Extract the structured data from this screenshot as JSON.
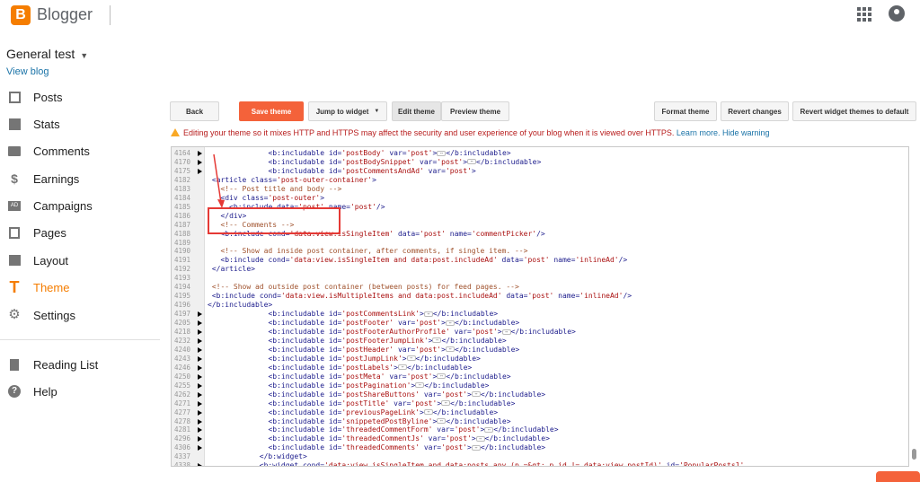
{
  "app": {
    "logo_letter": "B",
    "title": "Blogger"
  },
  "blog": {
    "name": "General test",
    "view_link": "View blog"
  },
  "sidebar": {
    "items": [
      {
        "label": "Posts",
        "icon": "posts-icon"
      },
      {
        "label": "Stats",
        "icon": "stats-icon"
      },
      {
        "label": "Comments",
        "icon": "comments-icon"
      },
      {
        "label": "Earnings",
        "icon": "earnings-icon"
      },
      {
        "label": "Campaigns",
        "icon": "campaigns-icon"
      },
      {
        "label": "Pages",
        "icon": "pages-icon"
      },
      {
        "label": "Layout",
        "icon": "layout-icon"
      },
      {
        "label": "Theme",
        "icon": "theme-icon",
        "active": true
      },
      {
        "label": "Settings",
        "icon": "settings-icon"
      }
    ],
    "secondary": [
      {
        "label": "Reading List",
        "icon": "reading-list-icon"
      },
      {
        "label": "Help",
        "icon": "help-icon"
      }
    ]
  },
  "toolbar": {
    "back": "Back",
    "save_theme": "Save theme",
    "jump_to_widget": "Jump to widget",
    "edit_theme": "Edit theme",
    "preview_theme": "Preview theme",
    "format_theme": "Format theme",
    "revert_changes": "Revert changes",
    "revert_widgets": "Revert widget themes to default"
  },
  "warning": {
    "message": "Editing your theme so it mixes HTTP and HTTPS may affect the security and user experience of your blog when it is viewed over HTTPS.",
    "learn_more": "Learn more.",
    "hide_warning": "Hide warning"
  },
  "code_lines": [
    {
      "ln": "4164",
      "fold": true,
      "indent": 14,
      "parts": [
        [
          "tag",
          "<b:includable "
        ],
        [
          "attr",
          "id="
        ],
        [
          "str",
          "'postBody'"
        ],
        [
          "attr",
          " var="
        ],
        [
          "str",
          "'post'"
        ],
        [
          "tag",
          ">"
        ],
        [
          "ell",
          ""
        ],
        [
          "tag",
          "</b:includable>"
        ]
      ]
    },
    {
      "ln": "4170",
      "fold": true,
      "indent": 14,
      "parts": [
        [
          "tag",
          "<b:includable "
        ],
        [
          "attr",
          "id="
        ],
        [
          "str",
          "'postBodySnippet'"
        ],
        [
          "attr",
          " var="
        ],
        [
          "str",
          "'post'"
        ],
        [
          "tag",
          ">"
        ],
        [
          "ell",
          ""
        ],
        [
          "tag",
          "</b:includable>"
        ]
      ]
    },
    {
      "ln": "4175",
      "fold": true,
      "indent": 14,
      "parts": [
        [
          "tag",
          "<b:includable "
        ],
        [
          "attr",
          "id="
        ],
        [
          "str",
          "'postCommentsAndAd'"
        ],
        [
          "attr",
          " var="
        ],
        [
          "str",
          "'post'"
        ],
        [
          "tag",
          ">"
        ]
      ]
    },
    {
      "ln": "4182",
      "fold": false,
      "indent": 1,
      "parts": [
        [
          "tag",
          "<article "
        ],
        [
          "attr",
          "class="
        ],
        [
          "str",
          "'post-outer-container'"
        ],
        [
          "tag",
          ">"
        ]
      ]
    },
    {
      "ln": "4183",
      "fold": false,
      "indent": 3,
      "parts": [
        [
          "cmt",
          "<!-- Post title and body -->"
        ]
      ]
    },
    {
      "ln": "4184",
      "fold": false,
      "indent": 3,
      "parts": [
        [
          "tag",
          "<div "
        ],
        [
          "attr",
          "class="
        ],
        [
          "str",
          "'post-outer'"
        ],
        [
          "tag",
          ">"
        ]
      ]
    },
    {
      "ln": "4185",
      "fold": false,
      "indent": 5,
      "parts": [
        [
          "tag",
          "<b:include "
        ],
        [
          "attr",
          "data="
        ],
        [
          "str",
          "'post'"
        ],
        [
          "attr",
          " name="
        ],
        [
          "str",
          "'post'"
        ],
        [
          "tag",
          "/>"
        ]
      ]
    },
    {
      "ln": "4186",
      "fold": false,
      "indent": 3,
      "parts": [
        [
          "tag",
          "</div>"
        ]
      ]
    },
    {
      "ln": "4187",
      "fold": false,
      "indent": 3,
      "parts": [
        [
          "cmt",
          "<!-- Comments -->"
        ]
      ]
    },
    {
      "ln": "4188",
      "fold": false,
      "indent": 3,
      "parts": [
        [
          "tag",
          "<b:include "
        ],
        [
          "attr",
          "cond="
        ],
        [
          "str",
          "'data:view.isSingleItem'"
        ],
        [
          "attr",
          " data="
        ],
        [
          "str",
          "'post'"
        ],
        [
          "attr",
          " name="
        ],
        [
          "str",
          "'commentPicker'"
        ],
        [
          "tag",
          "/>"
        ]
      ]
    },
    {
      "ln": "4189",
      "fold": false,
      "indent": 0,
      "parts": []
    },
    {
      "ln": "4190",
      "fold": false,
      "indent": 3,
      "parts": [
        [
          "cmt",
          "<!-- Show ad inside post container, after comments, if single item. -->"
        ]
      ]
    },
    {
      "ln": "4191",
      "fold": false,
      "indent": 3,
      "parts": [
        [
          "tag",
          "<b:include "
        ],
        [
          "attr",
          "cond="
        ],
        [
          "str",
          "'data:view.isSingleItem and data:post.includeAd'"
        ],
        [
          "attr",
          " data="
        ],
        [
          "str",
          "'post'"
        ],
        [
          "attr",
          " name="
        ],
        [
          "str",
          "'inlineAd'"
        ],
        [
          "tag",
          "/>"
        ]
      ]
    },
    {
      "ln": "4192",
      "fold": false,
      "indent": 1,
      "parts": [
        [
          "tag",
          "</article>"
        ]
      ]
    },
    {
      "ln": "4193",
      "fold": false,
      "indent": 0,
      "parts": []
    },
    {
      "ln": "4194",
      "fold": false,
      "indent": 1,
      "parts": [
        [
          "cmt",
          "<!-- Show ad outside post container (between posts) for feed pages. -->"
        ]
      ]
    },
    {
      "ln": "4195",
      "fold": false,
      "indent": 1,
      "parts": [
        [
          "tag",
          "<b:include "
        ],
        [
          "attr",
          "cond="
        ],
        [
          "str",
          "'data:view.isMultipleItems and data:post.includeAd'"
        ],
        [
          "attr",
          " data="
        ],
        [
          "str",
          "'post'"
        ],
        [
          "attr",
          " name="
        ],
        [
          "str",
          "'inlineAd'"
        ],
        [
          "tag",
          "/>"
        ]
      ]
    },
    {
      "ln": "4196",
      "fold": false,
      "indent": 0,
      "parts": [
        [
          "tag",
          "</b:includable>"
        ]
      ]
    },
    {
      "ln": "4197",
      "fold": true,
      "indent": 14,
      "parts": [
        [
          "tag",
          "<b:includable "
        ],
        [
          "attr",
          "id="
        ],
        [
          "str",
          "'postCommentsLink'"
        ],
        [
          "tag",
          ">"
        ],
        [
          "ell",
          ""
        ],
        [
          "tag",
          "</b:includable>"
        ]
      ]
    },
    {
      "ln": "4205",
      "fold": true,
      "indent": 14,
      "parts": [
        [
          "tag",
          "<b:includable "
        ],
        [
          "attr",
          "id="
        ],
        [
          "str",
          "'postFooter'"
        ],
        [
          "attr",
          " var="
        ],
        [
          "str",
          "'post'"
        ],
        [
          "tag",
          ">"
        ],
        [
          "ell",
          ""
        ],
        [
          "tag",
          "</b:includable>"
        ]
      ]
    },
    {
      "ln": "4218",
      "fold": true,
      "indent": 14,
      "parts": [
        [
          "tag",
          "<b:includable "
        ],
        [
          "attr",
          "id="
        ],
        [
          "str",
          "'postFooterAuthorProfile'"
        ],
        [
          "attr",
          " var="
        ],
        [
          "str",
          "'post'"
        ],
        [
          "tag",
          ">"
        ],
        [
          "ell",
          ""
        ],
        [
          "tag",
          "</b:includable>"
        ]
      ]
    },
    {
      "ln": "4232",
      "fold": true,
      "indent": 14,
      "parts": [
        [
          "tag",
          "<b:includable "
        ],
        [
          "attr",
          "id="
        ],
        [
          "str",
          "'postFooterJumpLink'"
        ],
        [
          "tag",
          ">"
        ],
        [
          "ell",
          ""
        ],
        [
          "tag",
          "</b:includable>"
        ]
      ]
    },
    {
      "ln": "4240",
      "fold": true,
      "indent": 14,
      "parts": [
        [
          "tag",
          "<b:includable "
        ],
        [
          "attr",
          "id="
        ],
        [
          "str",
          "'postHeader'"
        ],
        [
          "attr",
          " var="
        ],
        [
          "str",
          "'post'"
        ],
        [
          "tag",
          ">"
        ],
        [
          "ell",
          ""
        ],
        [
          "tag",
          "</b:includable>"
        ]
      ]
    },
    {
      "ln": "4243",
      "fold": true,
      "indent": 14,
      "parts": [
        [
          "tag",
          "<b:includable "
        ],
        [
          "attr",
          "id="
        ],
        [
          "str",
          "'postJumpLink'"
        ],
        [
          "tag",
          ">"
        ],
        [
          "ell",
          ""
        ],
        [
          "tag",
          "</b:includable>"
        ]
      ]
    },
    {
      "ln": "4246",
      "fold": true,
      "indent": 14,
      "parts": [
        [
          "tag",
          "<b:includable "
        ],
        [
          "attr",
          "id="
        ],
        [
          "str",
          "'postLabels'"
        ],
        [
          "tag",
          ">"
        ],
        [
          "ell",
          ""
        ],
        [
          "tag",
          "</b:includable>"
        ]
      ]
    },
    {
      "ln": "4250",
      "fold": true,
      "indent": 14,
      "parts": [
        [
          "tag",
          "<b:includable "
        ],
        [
          "attr",
          "id="
        ],
        [
          "str",
          "'postMeta'"
        ],
        [
          "attr",
          " var="
        ],
        [
          "str",
          "'post'"
        ],
        [
          "tag",
          ">"
        ],
        [
          "ell",
          ""
        ],
        [
          "tag",
          "</b:includable>"
        ]
      ]
    },
    {
      "ln": "4255",
      "fold": true,
      "indent": 14,
      "parts": [
        [
          "tag",
          "<b:includable "
        ],
        [
          "attr",
          "id="
        ],
        [
          "str",
          "'postPagination'"
        ],
        [
          "tag",
          ">"
        ],
        [
          "ell",
          ""
        ],
        [
          "tag",
          "</b:includable>"
        ]
      ]
    },
    {
      "ln": "4262",
      "fold": true,
      "indent": 14,
      "parts": [
        [
          "tag",
          "<b:includable "
        ],
        [
          "attr",
          "id="
        ],
        [
          "str",
          "'postShareButtons'"
        ],
        [
          "attr",
          " var="
        ],
        [
          "str",
          "'post'"
        ],
        [
          "tag",
          ">"
        ],
        [
          "ell",
          ""
        ],
        [
          "tag",
          "</b:includable>"
        ]
      ]
    },
    {
      "ln": "4271",
      "fold": true,
      "indent": 14,
      "parts": [
        [
          "tag",
          "<b:includable "
        ],
        [
          "attr",
          "id="
        ],
        [
          "str",
          "'postTitle'"
        ],
        [
          "attr",
          " var="
        ],
        [
          "str",
          "'post'"
        ],
        [
          "tag",
          ">"
        ],
        [
          "ell",
          ""
        ],
        [
          "tag",
          "</b:includable>"
        ]
      ]
    },
    {
      "ln": "4277",
      "fold": true,
      "indent": 14,
      "parts": [
        [
          "tag",
          "<b:includable "
        ],
        [
          "attr",
          "id="
        ],
        [
          "str",
          "'previousPageLink'"
        ],
        [
          "tag",
          ">"
        ],
        [
          "ell",
          ""
        ],
        [
          "tag",
          "</b:includable>"
        ]
      ]
    },
    {
      "ln": "4278",
      "fold": true,
      "indent": 14,
      "parts": [
        [
          "tag",
          "<b:includable "
        ],
        [
          "attr",
          "id="
        ],
        [
          "str",
          "'snippetedPostByline'"
        ],
        [
          "tag",
          ">"
        ],
        [
          "ell",
          ""
        ],
        [
          "tag",
          "</b:includable>"
        ]
      ]
    },
    {
      "ln": "4281",
      "fold": true,
      "indent": 14,
      "parts": [
        [
          "tag",
          "<b:includable "
        ],
        [
          "attr",
          "id="
        ],
        [
          "str",
          "'threadedCommentForm'"
        ],
        [
          "attr",
          " var="
        ],
        [
          "str",
          "'post'"
        ],
        [
          "tag",
          ">"
        ],
        [
          "ell",
          ""
        ],
        [
          "tag",
          "</b:includable>"
        ]
      ]
    },
    {
      "ln": "4296",
      "fold": true,
      "indent": 14,
      "parts": [
        [
          "tag",
          "<b:includable "
        ],
        [
          "attr",
          "id="
        ],
        [
          "str",
          "'threadedCommentJs'"
        ],
        [
          "attr",
          " var="
        ],
        [
          "str",
          "'post'"
        ],
        [
          "tag",
          ">"
        ],
        [
          "ell",
          ""
        ],
        [
          "tag",
          "</b:includable>"
        ]
      ]
    },
    {
      "ln": "4306",
      "fold": true,
      "indent": 14,
      "parts": [
        [
          "tag",
          "<b:includable "
        ],
        [
          "attr",
          "id="
        ],
        [
          "str",
          "'threadedComments'"
        ],
        [
          "attr",
          " var="
        ],
        [
          "str",
          "'post'"
        ],
        [
          "tag",
          ">"
        ],
        [
          "ell",
          ""
        ],
        [
          "tag",
          "</b:includable>"
        ]
      ]
    },
    {
      "ln": "4337",
      "fold": false,
      "indent": 12,
      "parts": [
        [
          "tag",
          "</b:widget>"
        ]
      ]
    },
    {
      "ln": "4338",
      "fold": true,
      "indent": 12,
      "parts": [
        [
          "tag",
          "<b:widget "
        ],
        [
          "attr",
          "cond="
        ],
        [
          "str",
          "'data:view.isSingleItem and data:posts any (p =&gt; p.id != data:view.postId)'"
        ],
        [
          "attr",
          " id="
        ],
        [
          "str",
          "'PopularPosts1'"
        ]
      ]
    }
  ],
  "colors": {
    "brand": "#f57d00",
    "save": "#f4623a",
    "annotation": "#e53935",
    "link": "#1a73a7"
  }
}
